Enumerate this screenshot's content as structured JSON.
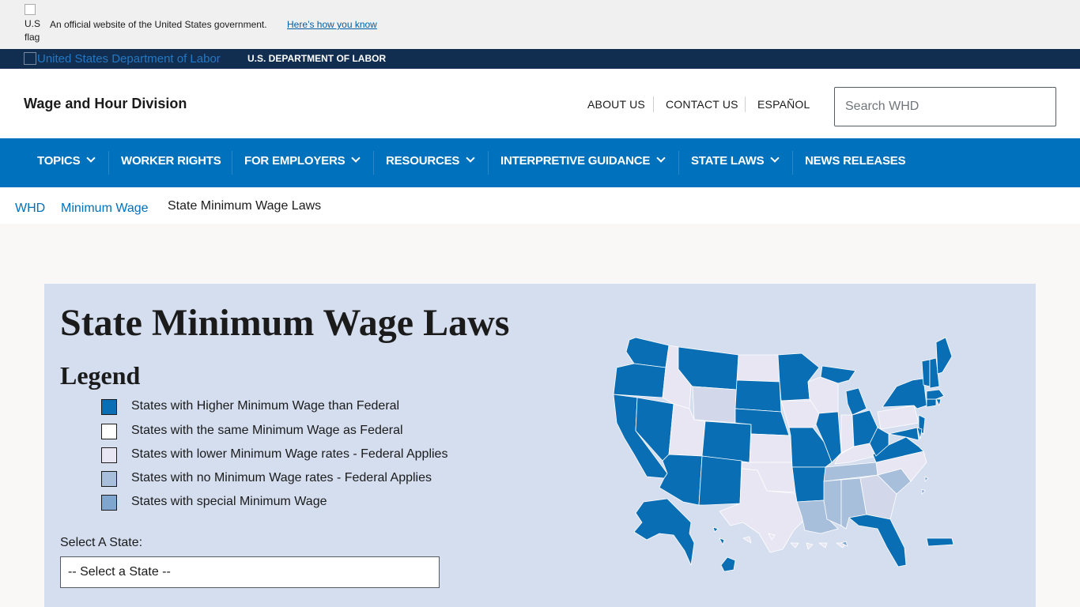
{
  "gov_banner": {
    "flag_alt": "U.S flag",
    "official_text": "An official website of the United States government.",
    "how_you_know": "Here’s how you know"
  },
  "dol_bar": {
    "logo_alt": "United States Department of Labor",
    "agency_name": "U.S. DEPARTMENT OF LABOR"
  },
  "header": {
    "site_title": "Wage and Hour Division",
    "utility_links": [
      "ABOUT US",
      "CONTACT US",
      "ESPAÑOL"
    ],
    "search_placeholder": "Search WHD"
  },
  "nav": {
    "items": [
      {
        "label": "TOPICS",
        "dropdown": true
      },
      {
        "label": "WORKER RIGHTS",
        "dropdown": false
      },
      {
        "label": "FOR EMPLOYERS",
        "dropdown": true
      },
      {
        "label": "RESOURCES",
        "dropdown": true
      },
      {
        "label": "INTERPRETIVE GUIDANCE",
        "dropdown": true
      },
      {
        "label": "STATE LAWS",
        "dropdown": true
      },
      {
        "label": "NEWS RELEASES",
        "dropdown": false
      }
    ]
  },
  "breadcrumb": {
    "items": [
      "WHD",
      "Minimum Wage"
    ],
    "current": "State Minimum Wage Laws"
  },
  "main": {
    "title": "State Minimum Wage Laws",
    "legend_title": "Legend",
    "legend": [
      {
        "label": "States with Higher Minimum Wage than Federal",
        "color": "#0a6eb4"
      },
      {
        "label": "States with the same Minimum Wage as Federal",
        "color": "#ffffff"
      },
      {
        "label": "States with lower Minimum Wage rates - Federal Applies",
        "color": "#e8e6f2"
      },
      {
        "label": "States with no Minimum Wage rates - Federal Applies",
        "color": "#a8bfdc"
      },
      {
        "label": "States with special Minimum Wage",
        "color": "#7ea6cf"
      }
    ],
    "select_label": "Select A State:",
    "select_value": "-- Select a State --"
  },
  "colors": {
    "gov_banner_bg": "#f0f0f0",
    "dol_bar_bg": "#112e51",
    "nav_bg": "#0071bc",
    "panel_bg": "#d4deef",
    "page_bg": "#faf8f6",
    "link": "#0071bc"
  }
}
